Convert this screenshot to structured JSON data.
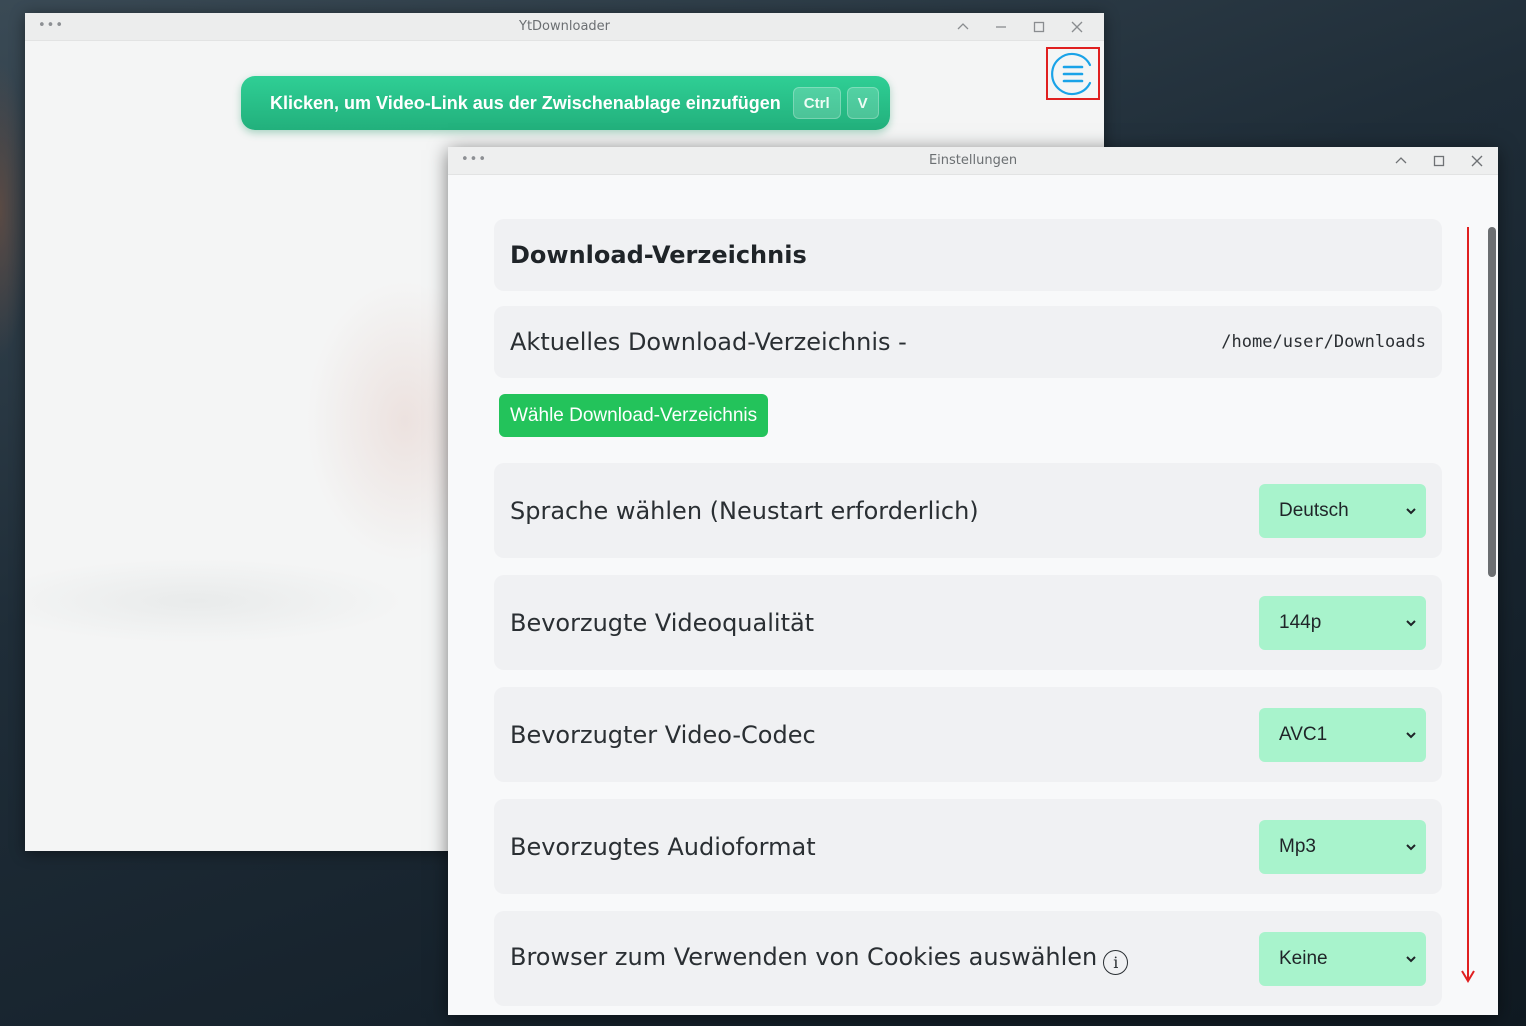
{
  "main_window": {
    "title": "YtDownloader",
    "title_dots": "•••",
    "paste_button": {
      "label": "Klicken, um Video-Link aus der Zwischenablage einzufügen",
      "shortcut_keys": [
        "Ctrl",
        "V"
      ]
    }
  },
  "settings_window": {
    "title": "Einstellungen",
    "title_dots": "•••",
    "section_title": "Download-Verzeichnis",
    "current_dir_label": "Aktuelles Download-Verzeichnis -",
    "current_dir_value": "/home/user/Downloads",
    "choose_dir_button": "Wähle Download-Verzeichnis",
    "settings": [
      {
        "label": "Sprache wählen (Neustart erforderlich)",
        "value": "Deutsch"
      },
      {
        "label": "Bevorzugte Videoqualität",
        "value": "144p"
      },
      {
        "label": "Bevorzugter Video-Codec",
        "value": "AVC1"
      },
      {
        "label": "Bevorzugtes Audioformat",
        "value": "Mp3"
      },
      {
        "label": "Browser zum Verwenden von Cookies auswählen",
        "value": "Keine"
      }
    ],
    "info_glyph": "i"
  },
  "colors": {
    "accent_green": "#23c35b",
    "paste_green": "#2fcf95",
    "select_bg": "#a8f3cc",
    "menu_icon": "#1aa3e8",
    "highlight_red": "#e02020"
  }
}
